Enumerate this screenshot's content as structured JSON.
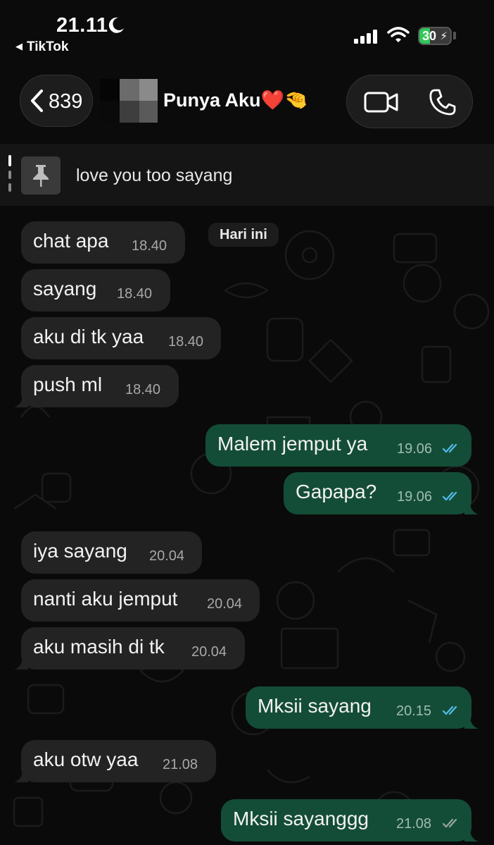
{
  "status_bar": {
    "time": "21.11",
    "back_app": "TikTok",
    "battery": "30"
  },
  "header": {
    "back_count": "839",
    "contact_name": "Punya Aku❤️🤏"
  },
  "pinned": {
    "text": "love you too sayang"
  },
  "chat": {
    "date_label": "Hari ini",
    "messages": [
      {
        "direction": "in",
        "text": "chat apa",
        "time": "18.40"
      },
      {
        "direction": "in",
        "text": "sayang",
        "time": "18.40"
      },
      {
        "direction": "in",
        "text": "aku di tk yaa",
        "time": "18.40"
      },
      {
        "direction": "in",
        "text": "push ml",
        "time": "18.40"
      },
      {
        "direction": "out",
        "text": "Malem jemput ya",
        "time": "19.06",
        "status": "read"
      },
      {
        "direction": "out",
        "text": "Gapapa?",
        "time": "19.06",
        "status": "read"
      },
      {
        "direction": "in",
        "text": "iya sayang",
        "time": "20.04"
      },
      {
        "direction": "in",
        "text": "nanti aku jemput",
        "time": "20.04"
      },
      {
        "direction": "in",
        "text": "aku masih di tk",
        "time": "20.04"
      },
      {
        "direction": "out",
        "text": "Mksii sayang",
        "time": "20.15",
        "status": "read"
      },
      {
        "direction": "in",
        "text": "aku otw yaa",
        "time": "21.08"
      },
      {
        "direction": "out",
        "text": "Mksii sayanggg",
        "time": "21.08",
        "status": "delivered"
      }
    ]
  },
  "colors": {
    "outgoing_bubble": "#144d37",
    "incoming_bubble": "#232323",
    "read_tick": "#53bdeb",
    "delivered_tick": "#9aa6a0"
  }
}
